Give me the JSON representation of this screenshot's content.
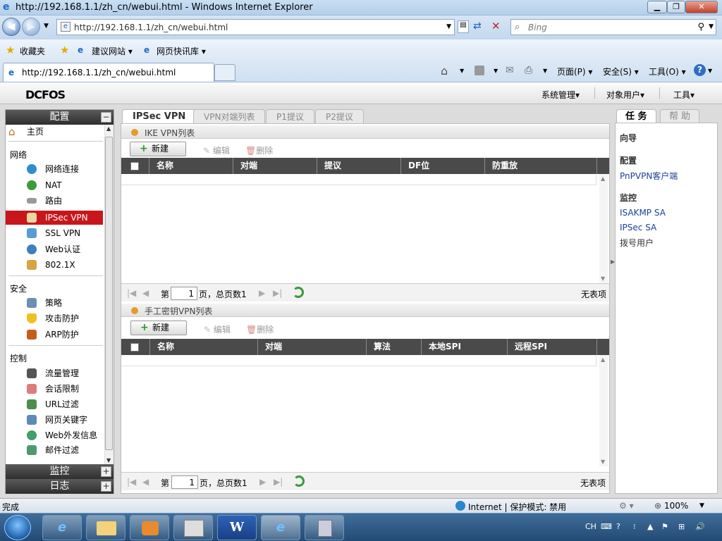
{
  "browser": {
    "title": "http://192.168.1.1/zh_cn/webui.html - Windows Internet Explorer",
    "address": "http://192.168.1.1/zh_cn/webui.html",
    "search_placeholder": "Bing",
    "favorites_label": "收藏夹",
    "fav_items": [
      "建议网站 ▾",
      "网页快讯库 ▾"
    ],
    "tab_title": "http://192.168.1.1/zh_cn/webui.html",
    "commands": [
      "页面(P) ▾",
      "安全(S) ▾",
      "工具(O) ▾"
    ]
  },
  "app": {
    "logo": "DCFOS",
    "top_menu": [
      "系统管理▾",
      "对象用户▾",
      "工具▾"
    ]
  },
  "sidebar": {
    "config_title": "配置",
    "home": "主页",
    "groups": [
      {
        "title": "网络",
        "items": [
          "网络连接",
          "NAT",
          "路由",
          "IPSec VPN",
          "SSL VPN",
          "Web认证",
          "802.1X"
        ]
      },
      {
        "title": "安全",
        "items": [
          "策略",
          "攻击防护",
          "ARP防护"
        ]
      },
      {
        "title": "控制",
        "items": [
          "流量管理",
          "会话限制",
          "URL过滤",
          "网页关键字",
          "Web外发信息",
          "邮件过滤"
        ]
      }
    ],
    "selected": "IPSec VPN",
    "monitor_title": "监控",
    "log_title": "日志",
    "expand_symbol": "+",
    "collapse_symbol": "−"
  },
  "main": {
    "tabs": [
      "IPSec VPN",
      "VPN对端列表",
      "P1提议",
      "P2提议"
    ],
    "active_tab": "IPSec VPN",
    "ike": {
      "title": "IKE VPN列表",
      "new_label": "新建",
      "edit_label": "编辑",
      "delete_label": "删除",
      "columns": [
        "名称",
        "对端",
        "提议",
        "DF位",
        "防重放"
      ],
      "pager": {
        "prefix": "第",
        "page": "1",
        "suffix": "页，总页数1",
        "empty": "无表项"
      }
    },
    "manual": {
      "title": "手工密钥VPN列表",
      "new_label": "新建",
      "edit_label": "编辑",
      "delete_label": "删除",
      "columns": [
        "名称",
        "对端",
        "算法",
        "本地SPI",
        "远程SPI"
      ],
      "pager": {
        "prefix": "第",
        "page": "1",
        "suffix": "页，总页数1",
        "empty": "无表项"
      }
    }
  },
  "right_panel": {
    "tabs": [
      "任 务",
      "帮 助"
    ],
    "wizard": "向导",
    "config_head": "配置",
    "config_links": [
      "PnPVPN客户端"
    ],
    "monitor_head": "监控",
    "monitor_links": [
      "ISAKMP SA",
      "IPSec SA",
      "拨号用户"
    ]
  },
  "statusbar": {
    "left": "完成",
    "zone": "Internet | 保护模式: 禁用",
    "zoom": "100%"
  },
  "taskbar": {
    "lang": "CH",
    "word_label": "W"
  }
}
